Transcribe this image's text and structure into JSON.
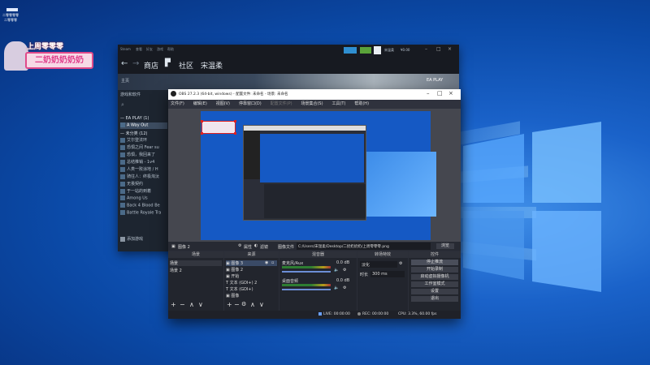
{
  "desktop": {
    "corner_text": [
      "二零零零零",
      "二零零零"
    ]
  },
  "badge": {
    "line1": "上周零零零",
    "line2": "二奶奶奶奶奶"
  },
  "steam": {
    "nav": {
      "store": "商店",
      "community": "社区",
      "user": "宋温柔"
    },
    "top_menu": [
      "Steam",
      "查看",
      "好友",
      "游戏",
      "帮助"
    ],
    "top_right": {
      "user": "宋温柔",
      "balance": "¥0.00"
    },
    "banner_home": "主页",
    "banner_tag": "EA PLAY",
    "sidebar_title": "游戏和软件",
    "groups": [
      {
        "name": "— EA PLAY",
        "count": "(1)",
        "items": [
          "A Way Out"
        ]
      },
      {
        "name": "— 未分类",
        "count": "(12)",
        "items": [
          "艾尔登法环",
          "恐惧之间 Fear su",
          "恐惧，我回来了",
          "总结推销 - 1v4",
          "人类一败涂地 / H",
          "骑往人：终极淘汰",
          "无畏契约",
          "于一站的到着",
          "Among Us",
          "Back 4 Blood Be",
          "Battle Royale Tra"
        ]
      }
    ],
    "add_game": "添加游戏"
  },
  "obs": {
    "title": "OBS 27.2.3 (64-bit, windows) - 配置文件: 未命名 - 场景: 未命名",
    "menu": [
      "文件(F)",
      "编辑(E)",
      "视图(V)",
      "停靠窗口(D)",
      "配置文件(P)",
      "场景集合(S)",
      "工具(T)",
      "帮助(H)"
    ],
    "info_bar": {
      "source": "图像 2",
      "properties": "属性",
      "filters": "滤镜",
      "image_file_label": "图像文件",
      "path": "C:/Users/宋温柔/Desktop/二奶奶奶奶/上周零零零.png",
      "browse": "浏览"
    },
    "docks": {
      "scenes": {
        "title": "场景",
        "items": [
          "场景",
          "场景 2"
        ]
      },
      "sources": {
        "title": "来源",
        "items": [
          "图像 3",
          "图像 2",
          "开始",
          "文本 (GDI+) 2",
          "文本 (GDI+)",
          "图像"
        ]
      },
      "mixer": {
        "title": "混音器",
        "channels": [
          {
            "name": "麦克风/Aux",
            "db": "0.0 dB"
          },
          {
            "name": "桌面音频",
            "db": "0.0 dB"
          }
        ]
      },
      "transitions": {
        "title": "转场特效",
        "type": "淡化",
        "duration_label": "时长",
        "duration": "300 ms"
      },
      "controls": {
        "title": "控件",
        "buttons": [
          "停止推流",
          "开始录制",
          "启动虚拟摄像机",
          "工作室模式",
          "设置",
          "退出"
        ]
      }
    },
    "status": {
      "live": "LIVE: 00:00:00",
      "rec": "REC: 00:00:00",
      "cpu": "CPU: 3.3%, 60.00 fps"
    }
  }
}
